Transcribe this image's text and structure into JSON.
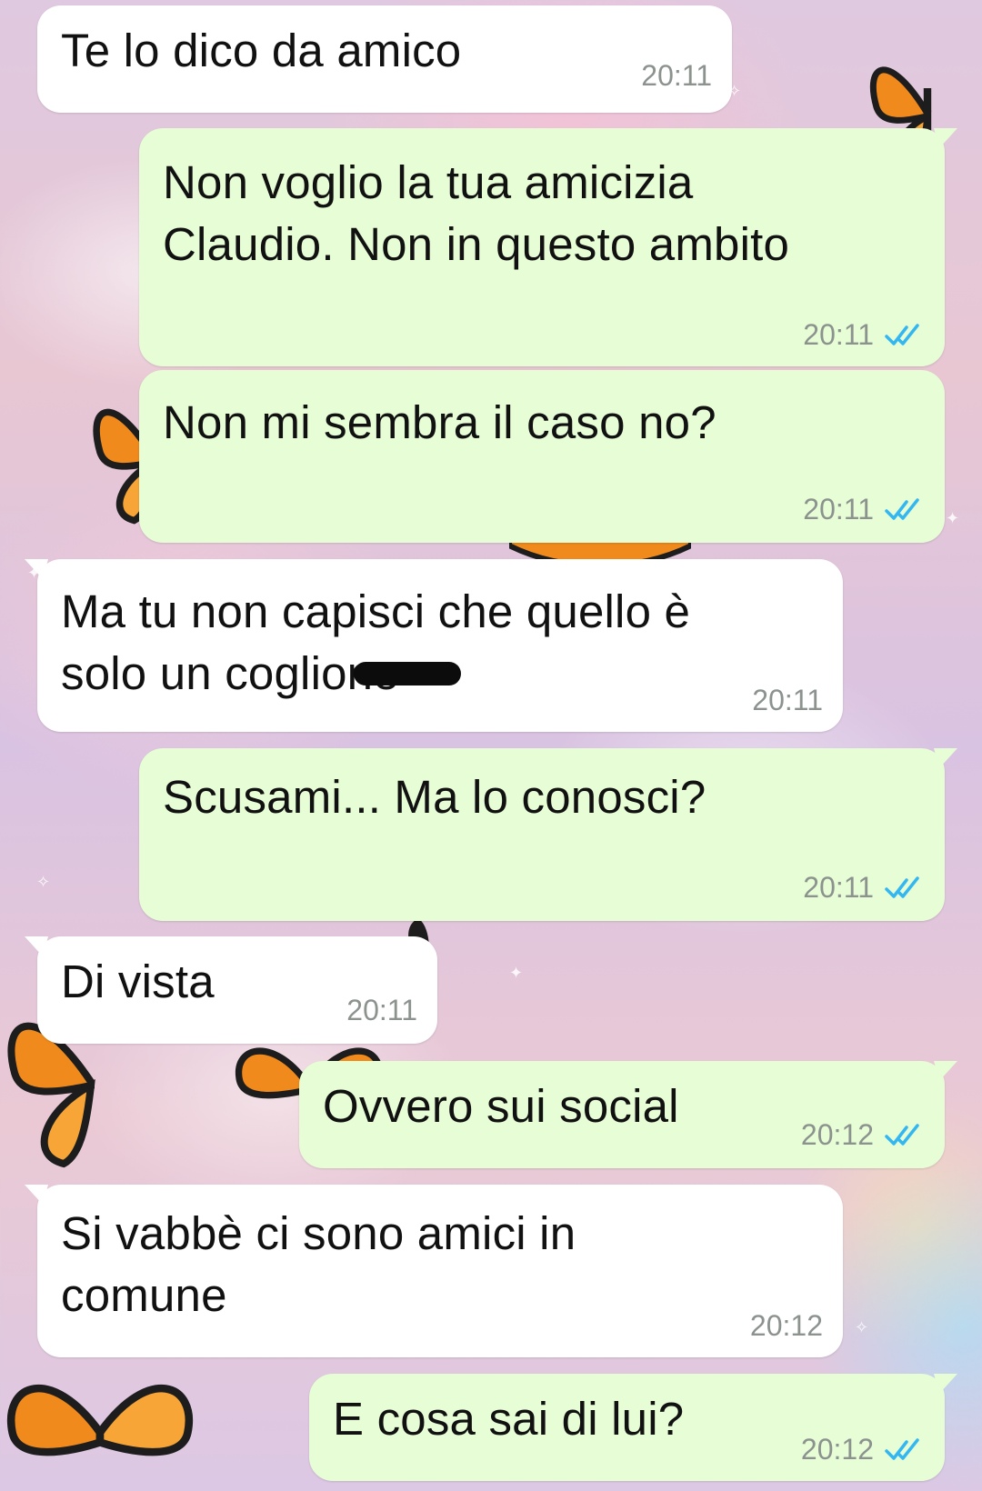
{
  "chat": {
    "messages": [
      {
        "direction": "incoming",
        "text": "Te lo dico da amico",
        "time": "20:11"
      },
      {
        "direction": "outgoing",
        "text": "Non voglio la tua amicizia\nClaudio. Non in questo ambito",
        "time": "20:11",
        "status": "read"
      },
      {
        "direction": "outgoing",
        "text": "Non mi sembra il caso no?",
        "time": "20:11",
        "status": "read"
      },
      {
        "direction": "incoming",
        "text": "Ma tu non capisci che quello è\nsolo un coglione",
        "time": "20:11"
      },
      {
        "direction": "outgoing",
        "text": "Scusami... Ma lo conosci?",
        "time": "20:11",
        "status": "read"
      },
      {
        "direction": "incoming",
        "text": "Di vista",
        "time": "20:11"
      },
      {
        "direction": "outgoing",
        "text": "Ovvero sui social",
        "time": "20:12",
        "status": "read"
      },
      {
        "direction": "incoming",
        "text": "Si vabbè ci sono amici in\ncomune",
        "time": "20:12"
      },
      {
        "direction": "outgoing",
        "text": "E cosa sai di lui?",
        "time": "20:12",
        "status": "read"
      }
    ]
  },
  "colors": {
    "incoming_bubble": "#ffffff",
    "outgoing_bubble": "#e6fdd6",
    "timestamp": "#8c938e",
    "read_ticks": "#34b7f1"
  },
  "icons": {
    "read_receipt": "double-check-icon",
    "wallpaper": "butterfly-cloud-wallpaper"
  }
}
